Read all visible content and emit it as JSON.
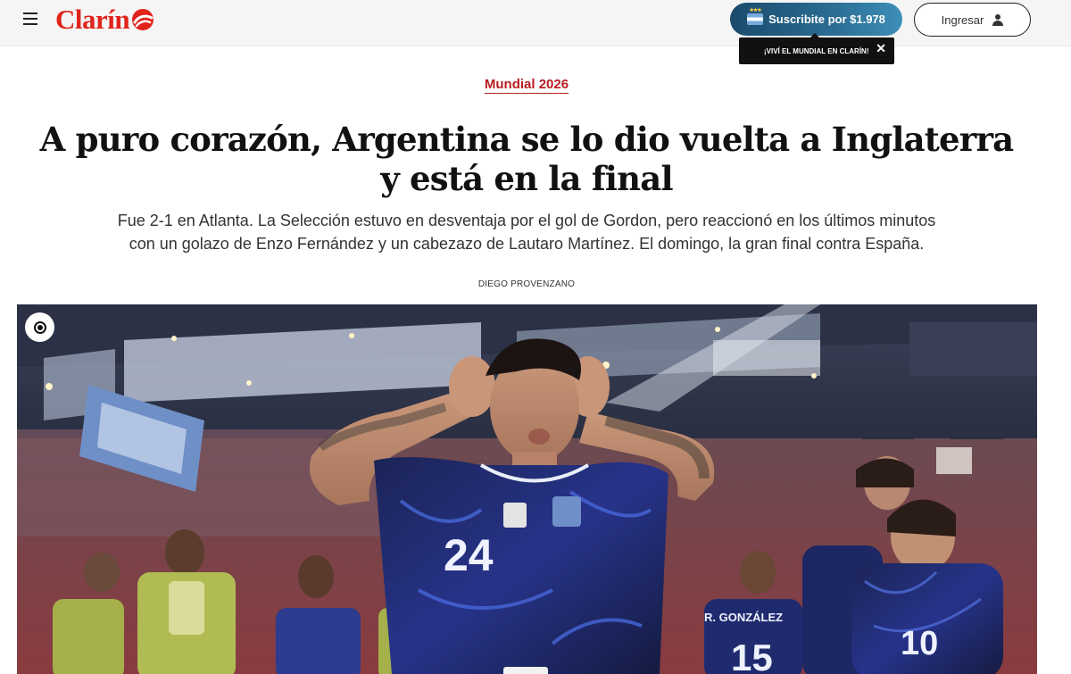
{
  "header": {
    "logo_text": "Clarín",
    "subscribe_label": "Suscribite por $1.978",
    "login_label": "Ingresar",
    "tooltip_text": "¡VIVÍ EL MUNDIAL EN CLARÍN!",
    "tooltip_close": "✕"
  },
  "article": {
    "section": "Mundial 2026",
    "headline": "A puro corazón, Argentina se lo dio vuelta a Inglaterra y está en la final",
    "dek": "Fue 2-1 en Atlanta. La Selección estuvo en desventaja por el gol de Gordon, pero reaccionó en los últimos minutos con un golazo de Enzo Fernández y un cabezazo de Lautaro Martínez. El domingo, la gran final contra España.",
    "byline": "DIEGO PROVENZANO"
  },
  "photo": {
    "player_number": "24",
    "right_player_number": "10",
    "mid_player_number": "15",
    "mid_player_name": "R. GONZÁLEZ"
  },
  "colors": {
    "brand_red": "#e1241b",
    "section_red": "#b81c22",
    "subscribe_blue": "#2b6d93"
  },
  "icons": [
    "hamburger-menu-icon",
    "argentina-flag-icon",
    "user-icon",
    "close-icon",
    "target-icon"
  ]
}
